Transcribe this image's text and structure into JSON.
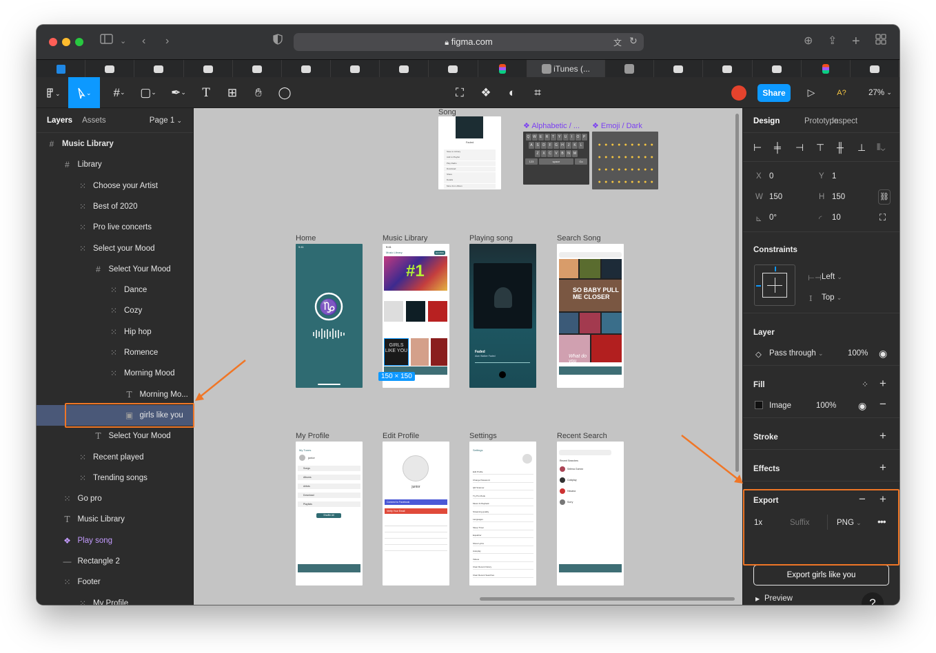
{
  "browser": {
    "url": "figma.com",
    "tabs": [
      "",
      "",
      "",
      "",
      "",
      "",
      "",
      "",
      "",
      "",
      "",
      "",
      "",
      ""
    ],
    "active_tab_title": "iTunes (..."
  },
  "toolbar": {
    "share_label": "Share",
    "zoom": "27%",
    "a_label": "A?"
  },
  "left_panel": {
    "tab_layers": "Layers",
    "tab_assets": "Assets",
    "page": "Page 1",
    "layers": [
      {
        "label": "Music Library",
        "icon": "frame-icon",
        "depth": 0
      },
      {
        "label": "Library",
        "icon": "frame-icon",
        "depth": 1
      },
      {
        "label": "Choose your Artist",
        "icon": "group-icon",
        "depth": 2
      },
      {
        "label": "Best of 2020",
        "icon": "group-icon",
        "depth": 2
      },
      {
        "label": "Pro live concerts",
        "icon": "group-icon",
        "depth": 2
      },
      {
        "label": "Select your Mood",
        "icon": "group-icon",
        "depth": 2
      },
      {
        "label": "Select Your Mood",
        "icon": "frame-icon",
        "depth": 3
      },
      {
        "label": "Dance",
        "icon": "group-icon",
        "depth": 4
      },
      {
        "label": "Cozy",
        "icon": "group-icon",
        "depth": 4
      },
      {
        "label": "Hip hop",
        "icon": "group-icon",
        "depth": 4
      },
      {
        "label": "Romence",
        "icon": "group-icon",
        "depth": 4
      },
      {
        "label": "Morning Mood",
        "icon": "group-icon",
        "depth": 4
      },
      {
        "label": "Morning Mo...",
        "icon": "text-icon",
        "depth": 5
      },
      {
        "label": "girls like you",
        "icon": "image-icon",
        "depth": 5,
        "selected": true
      },
      {
        "label": "Select Your Mood",
        "icon": "text-icon",
        "depth": 3
      },
      {
        "label": "Recent played",
        "icon": "group-icon",
        "depth": 2
      },
      {
        "label": "Trending songs",
        "icon": "group-icon",
        "depth": 2
      },
      {
        "label": "Go pro",
        "icon": "group-icon",
        "depth": 1
      },
      {
        "label": "Music Library",
        "icon": "text-icon",
        "depth": 1
      },
      {
        "label": "Play song",
        "icon": "component-icon",
        "depth": 1
      },
      {
        "label": "Rectangle 2",
        "icon": "line-icon",
        "depth": 1
      },
      {
        "label": "Footer",
        "icon": "group-icon",
        "depth": 1
      },
      {
        "label": "My Profile",
        "icon": "group-icon",
        "depth": 2
      }
    ]
  },
  "canvas": {
    "frames": [
      {
        "label": "Song"
      },
      {
        "label": "Alphabetic / ..."
      },
      {
        "label": "Emoji / Dark"
      },
      {
        "label": "Home"
      },
      {
        "label": "Music Library"
      },
      {
        "label": "Playing song"
      },
      {
        "label": "Search Song"
      },
      {
        "label": "My Profile"
      },
      {
        "label": "Edit Profile"
      },
      {
        "label": "Settings"
      },
      {
        "label": "Recent Search"
      }
    ],
    "selection_size": "150 × 150",
    "mini": {
      "time": "9:41",
      "faded": "Faded",
      "artist": "Alan Walker Faded",
      "junior": "junior",
      "shuffle": "Shuffle All",
      "connect_fb": "Connect to Facebook",
      "verify": "Verify Your Email",
      "settings": "Settings",
      "my_tunes": "My Tunes",
      "recent_searches": "Recent Searches",
      "music_library": "Music Library",
      "number_one": "#1",
      "so_baby": "SO BABY PULL ME CLOSER",
      "girls": "GIRLS LIKE YOU",
      "what_do_you": "What do you",
      "go_pro": "GO PRO",
      "song_items": [
        "Save to Library",
        "Add to Playlist",
        "Play Radio",
        "Download",
        "Share",
        "Details",
        "More from Album"
      ],
      "cancel": "Cancel",
      "profile_items": [
        "Songs",
        "Albums",
        "Artists",
        "Download",
        "Playlists"
      ],
      "recent_names": [
        "Selena Gomez",
        "Coldplay",
        "Havana",
        "Sorry"
      ],
      "settings_items": [
        "Edit Profile",
        "Change Password",
        "QR Scanner",
        "Try Pro Mode",
        "Music & Playback",
        "Streaming quality",
        "Languages",
        "Sleep Timer",
        "Equalizer",
        "Show Lyrics",
        "Autoplay",
        "Videos",
        "Clear Recent history",
        "Clear Recent Searches"
      ],
      "keyboard_rows": [
        "QWERTYUIOP",
        "ASDFGHJKL",
        "ZXCVBNM"
      ],
      "space": "space",
      "go": "Go",
      "num": "123"
    }
  },
  "right_panel": {
    "tabs": [
      "Design",
      "Prototype",
      "Inspect"
    ],
    "x_label": "X",
    "x": "0",
    "y_label": "Y",
    "y": "1",
    "w_label": "W",
    "w": "150",
    "h_label": "H",
    "h": "150",
    "rotation": "0°",
    "radius": "10",
    "constraints_title": "Constraints",
    "constraint_h": "Left",
    "constraint_v": "Top",
    "layer_title": "Layer",
    "blend": "Pass through",
    "opacity": "100%",
    "fill_title": "Fill",
    "fill_type": "Image",
    "fill_opacity": "100%",
    "stroke_title": "Stroke",
    "effects_title": "Effects",
    "export_title": "Export",
    "export_scale": "1x",
    "export_suffix": "Suffix",
    "export_format": "PNG",
    "export_button": "Export girls like you",
    "preview": "Preview",
    "help": "?"
  },
  "colors": {
    "accent": "#0d99ff",
    "annotation": "#f07626",
    "selection_row": "#4a5878",
    "component": "#c49cff",
    "teal": "#2f6b72"
  }
}
